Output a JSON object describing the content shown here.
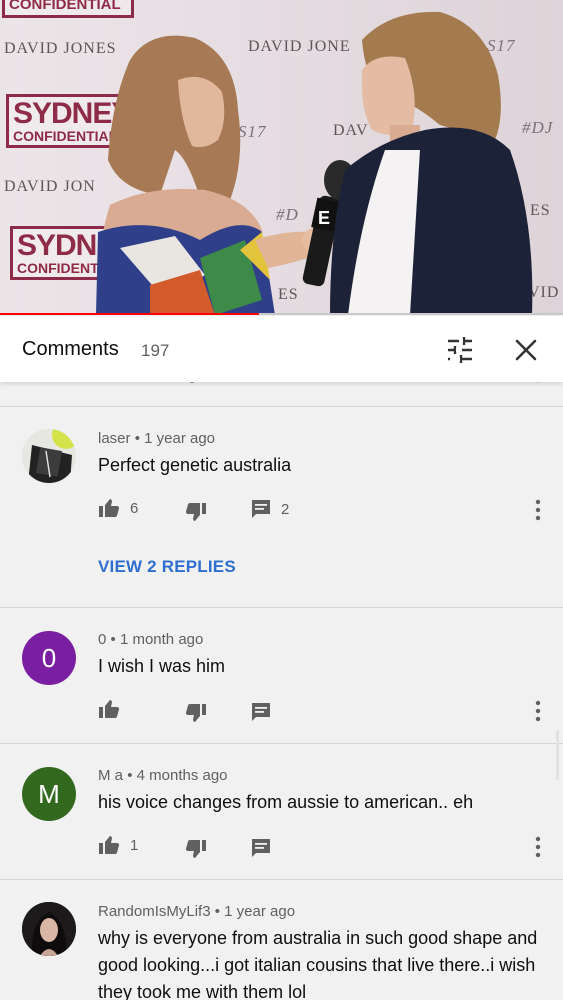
{
  "video": {
    "wall_text": {
      "top_partial": "CONFIDENTIAL",
      "david_jones_1": "DAVID JONES",
      "david_jones_2": "DAVID JONE",
      "david_jones_3": "DAVID JON",
      "david_jones_4": "DAV",
      "hashtag_1": "S17",
      "hashtag_2": "S17",
      "hashtag_3": "#DJ",
      "hashtag_4": "#D",
      "hashtag_5": "ES",
      "hashtag_6": "ES",
      "hashtag_7": "VID",
      "logo_1_big": "SYDNEY",
      "logo_1_small": "CONFIDENTIAL",
      "logo_2_big": "SYDNE",
      "logo_2_small": "CONFIDENT"
    },
    "mic_flag": "E",
    "progress_fraction": 0.46
  },
  "header": {
    "title": "Comments",
    "count": "197",
    "icons": {
      "sort": "sort-options-icon",
      "close": "close-icon"
    }
  },
  "comments": [
    {
      "author": "laser",
      "time": "1 year ago",
      "text": "Perfect genetic australia",
      "likes": "6",
      "replies": "2",
      "view_replies": "VIEW 2 REPLIES",
      "avatar_letter": "",
      "avatar_color": "#6f7a55"
    },
    {
      "author": "0",
      "time": "1 month ago",
      "text": "I wish I was him",
      "likes": "",
      "replies": "",
      "avatar_letter": "0",
      "avatar_color": "#7b1fa2"
    },
    {
      "author": "M a",
      "time": "4 months ago",
      "text": "his voice changes from aussie to american.. eh",
      "likes": "1",
      "replies": "",
      "avatar_letter": "M",
      "avatar_color": "#33691e"
    },
    {
      "author": "RandomIsMyLif3",
      "time": "1 year ago",
      "text": "why is everyone from australia in such good shape and good looking...i got italian cousins that live there..i wish they took me with them lol",
      "avatar_letter": "",
      "avatar_color": "#2a2326"
    }
  ],
  "separator": "•",
  "colors": {
    "link": "#2e6fd0",
    "progress": "#ff0000",
    "background": "#f1f1f1"
  }
}
